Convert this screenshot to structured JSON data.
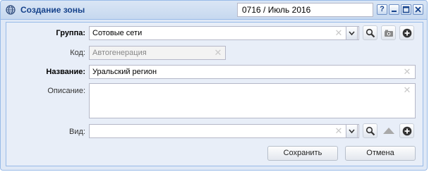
{
  "window": {
    "title": "Создание зоны",
    "period": "0716 / Июль 2016",
    "controls": [
      "help-icon",
      "minimize-icon",
      "maximize-icon",
      "close-icon"
    ]
  },
  "form": {
    "group": {
      "label": "Группа:",
      "value": "Сотовые сети"
    },
    "code": {
      "label": "Код:",
      "value": "Автогенерация"
    },
    "name": {
      "label": "Название:",
      "value": "Уральский регион"
    },
    "description": {
      "label": "Описание:",
      "value": ""
    },
    "kind": {
      "label": "Вид:",
      "value": ""
    }
  },
  "buttons": {
    "save": "Сохранить",
    "cancel": "Отмена"
  },
  "icons": {
    "clear": "✕",
    "help": "?",
    "dropdown": "chevron-down-icon",
    "search": "search-icon",
    "folder": "folder-camera-icon",
    "add": "plus-circle-icon",
    "up": "triangle-up-icon"
  }
}
